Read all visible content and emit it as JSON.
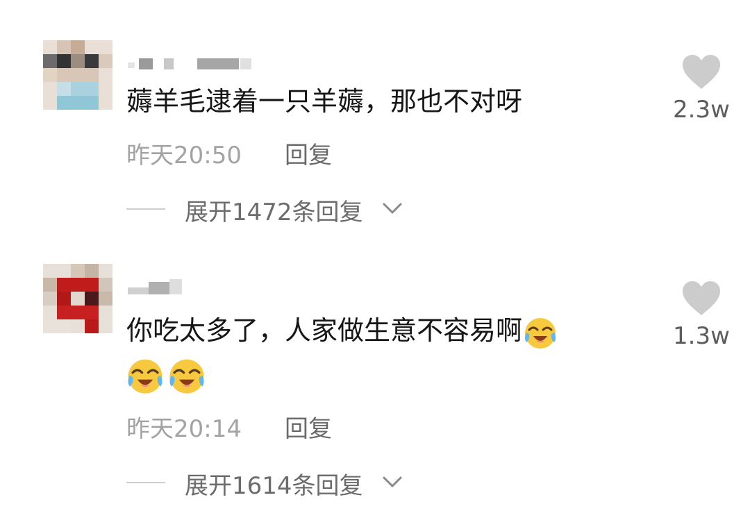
{
  "comments": [
    {
      "text": "薅羊毛逮着一只羊薅，那也不对呀",
      "time": "昨天20:50",
      "reply_label": "回复",
      "expand_label": "展开1472条回复",
      "likes": "2.3w"
    },
    {
      "text": "你吃太多了，人家做生意不容易啊",
      "time": "昨天20:14",
      "reply_label": "回复",
      "expand_label": "展开1614条回复",
      "likes": "1.3w"
    }
  ],
  "icons": {
    "heart": "heart-icon",
    "chevron": "chevron-down-icon",
    "emoji": "crying-laughing-face"
  },
  "colors": {
    "text": "#161616",
    "meta": "#a3a3a3",
    "heart": "#cccccc"
  }
}
